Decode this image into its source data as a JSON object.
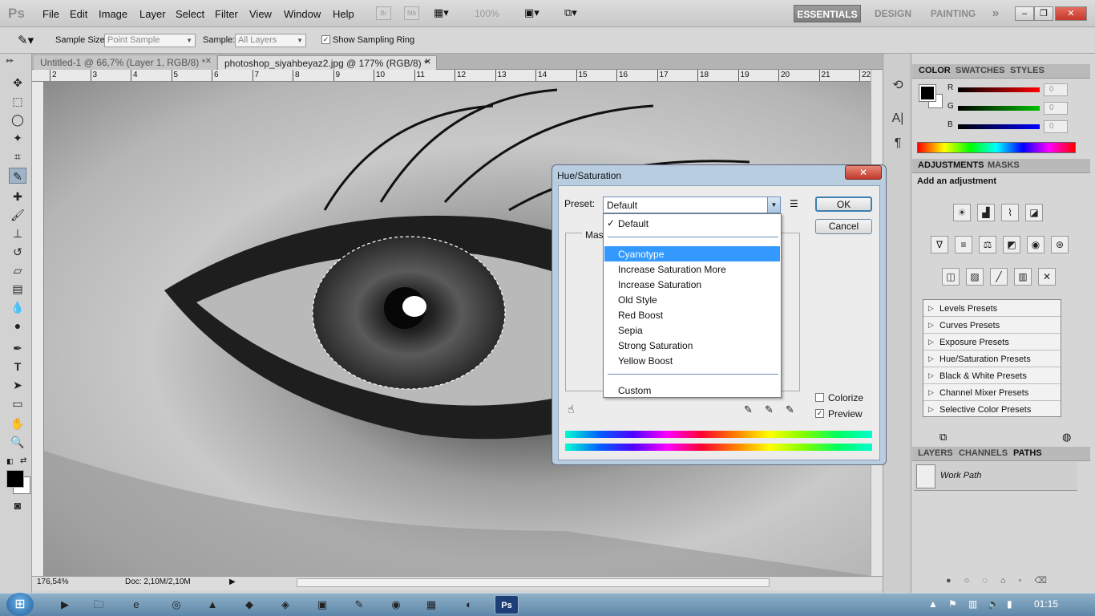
{
  "menubar": {
    "logo": "Ps",
    "items": [
      "File",
      "Edit",
      "Image",
      "Layer",
      "Select",
      "Filter",
      "View",
      "Window",
      "Help"
    ],
    "icons": [
      "Br",
      "Mb"
    ],
    "zoom": "100%",
    "workspaces": [
      "ESSENTIALS",
      "DESIGN",
      "PAINTING"
    ],
    "more": "»",
    "window_controls": {
      "minimize": "–",
      "restore": "❐",
      "close": "✕"
    }
  },
  "options": {
    "sample_size_label": "Sample Size:",
    "sample_size_value": "Point Sample",
    "sample_label": "Sample:",
    "sample_value": "All Layers",
    "sampling_ring_label": "Show Sampling Ring",
    "sampling_ring_checked": true
  },
  "tabs": [
    {
      "label": "Untitled-1 @ 66,7% (Layer 1, RGB/8) *",
      "close": "✕"
    },
    {
      "label": "photoshop_siyahbeyaz2.jpg @ 177% (RGB/8) *",
      "close": "✕"
    }
  ],
  "ruler": [
    "2",
    "3",
    "4",
    "5",
    "6",
    "7",
    "8",
    "9",
    "10",
    "11",
    "12",
    "13",
    "14",
    "15",
    "16",
    "17",
    "18",
    "19",
    "20",
    "21",
    "22"
  ],
  "status": {
    "zoom": "176,54%",
    "doc": "Doc: 2,10M/2,10M"
  },
  "color_panel": {
    "tabs": [
      "COLOR",
      "SWATCHES",
      "STYLES"
    ],
    "channels": [
      {
        "label": "R",
        "value": "0",
        "color": "#ff0000"
      },
      {
        "label": "G",
        "value": "0",
        "color": "#00c000"
      },
      {
        "label": "B",
        "value": "0",
        "color": "#0000ff"
      }
    ]
  },
  "adjustments_panel": {
    "tabs": [
      "ADJUSTMENTS",
      "MASKS"
    ],
    "heading": "Add an adjustment",
    "presets": [
      "Levels Presets",
      "Curves Presets",
      "Exposure Presets",
      "Hue/Saturation Presets",
      "Black & White Presets",
      "Channel Mixer Presets",
      "Selective Color Presets"
    ]
  },
  "layers_panel": {
    "tabs": [
      "LAYERS",
      "CHANNELS",
      "PATHS"
    ],
    "path_name": "Work Path"
  },
  "dialog": {
    "title": "Hue/Saturation",
    "close": "✕",
    "preset_label": "Preset:",
    "preset_value": "Default",
    "master_label": "Mas",
    "ok": "OK",
    "cancel": "Cancel",
    "colorize_label": "Colorize",
    "colorize_checked": false,
    "preview_label": "Preview",
    "preview_checked": true,
    "dropdown": {
      "checked_item": "Default",
      "checkmark": "✓",
      "highlighted": "Cyanotype",
      "items": [
        "Cyanotype",
        "Increase Saturation More",
        "Increase Saturation",
        "Old Style",
        "Red Boost",
        "Sepia",
        "Strong Saturation",
        "Yellow Boost"
      ],
      "last": "Custom"
    }
  },
  "taskbar": {
    "clock": "01:15",
    "apps": [
      "media-player",
      "explorer",
      "internet-explorer",
      "chrome",
      "acrobat",
      "app-6",
      "app-7",
      "app-8",
      "app-9",
      "app-10",
      "app-11",
      "app-12",
      "photoshop"
    ],
    "active_app": "Ps"
  }
}
